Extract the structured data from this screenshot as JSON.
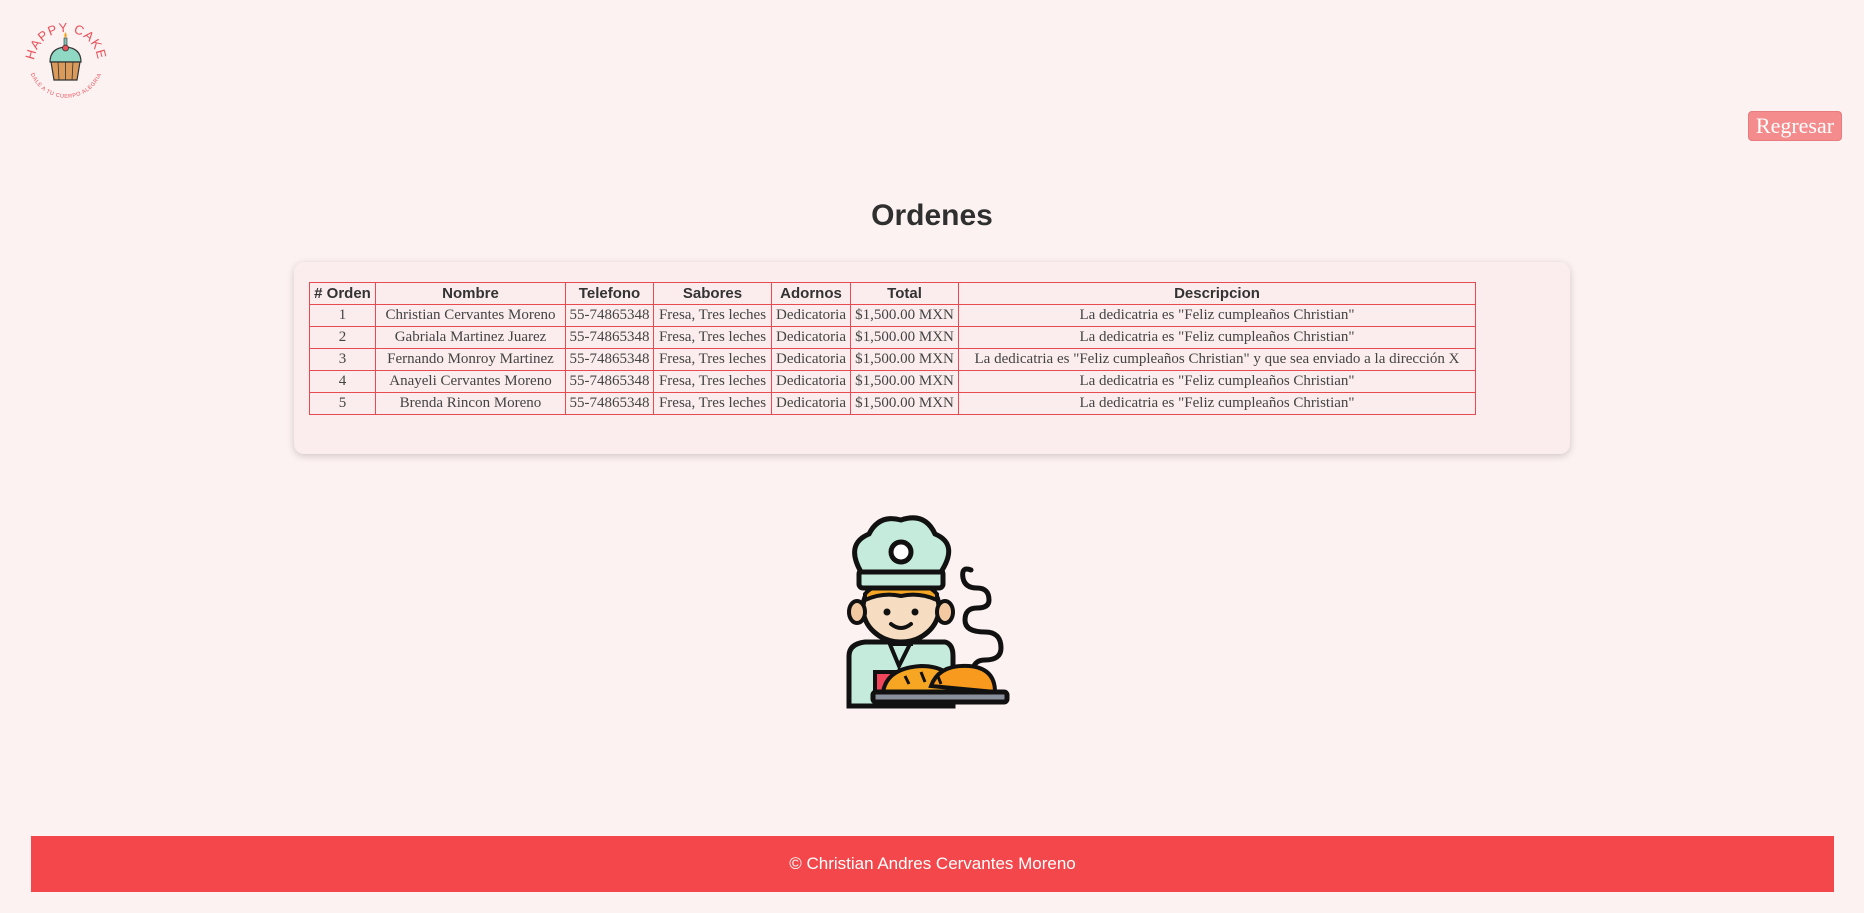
{
  "header": {
    "logo_text": "HAPPY CAKE",
    "logo_tagline": "DALE A TU CUERPO ALEGRIA",
    "back_button": "Regresar"
  },
  "main": {
    "title": "Ordenes",
    "table": {
      "headers": [
        "# Orden",
        "Nombre",
        "Telefono",
        "Sabores",
        "Adornos",
        "Total",
        "Descripcion"
      ],
      "rows": [
        [
          "1",
          "Christian Cervantes Moreno",
          "55-74865348",
          "Fresa, Tres leches",
          "Dedicatoria",
          "$1,500.00 MXN",
          "La dedicatria es \"Feliz cumpleaños Christian\""
        ],
        [
          "2",
          "Gabriala Martinez Juarez",
          "55-74865348",
          "Fresa, Tres leches",
          "Dedicatoria",
          "$1,500.00 MXN",
          "La dedicatria es \"Feliz cumpleaños Christian\""
        ],
        [
          "3",
          "Fernando Monroy Martinez",
          "55-74865348",
          "Fresa, Tres leches",
          "Dedicatoria",
          "$1,500.00 MXN",
          "La dedicatria es \"Feliz cumpleaños Christian\" y que sea enviado a la dirección X"
        ],
        [
          "4",
          "Anayeli Cervantes Moreno",
          "55-74865348",
          "Fresa, Tres leches",
          "Dedicatoria",
          "$1,500.00 MXN",
          "La dedicatria es \"Feliz cumpleaños Christian\""
        ],
        [
          "5",
          "Brenda Rincon Moreno",
          "55-74865348",
          "Fresa, Tres leches",
          "Dedicatoria",
          "$1,500.00 MXN",
          "La dedicatria es \"Feliz cumpleaños Christian\""
        ]
      ]
    }
  },
  "footer": {
    "copyright": "© Christian Andres Cervantes Moreno"
  },
  "icons": {
    "logo": "cupcake-logo-icon",
    "illustration": "chef-baker-icon"
  },
  "colors": {
    "background": "#fdf2f2",
    "accent": "#f4474b",
    "button": "#f48b8c",
    "table_border": "#e84a52"
  }
}
